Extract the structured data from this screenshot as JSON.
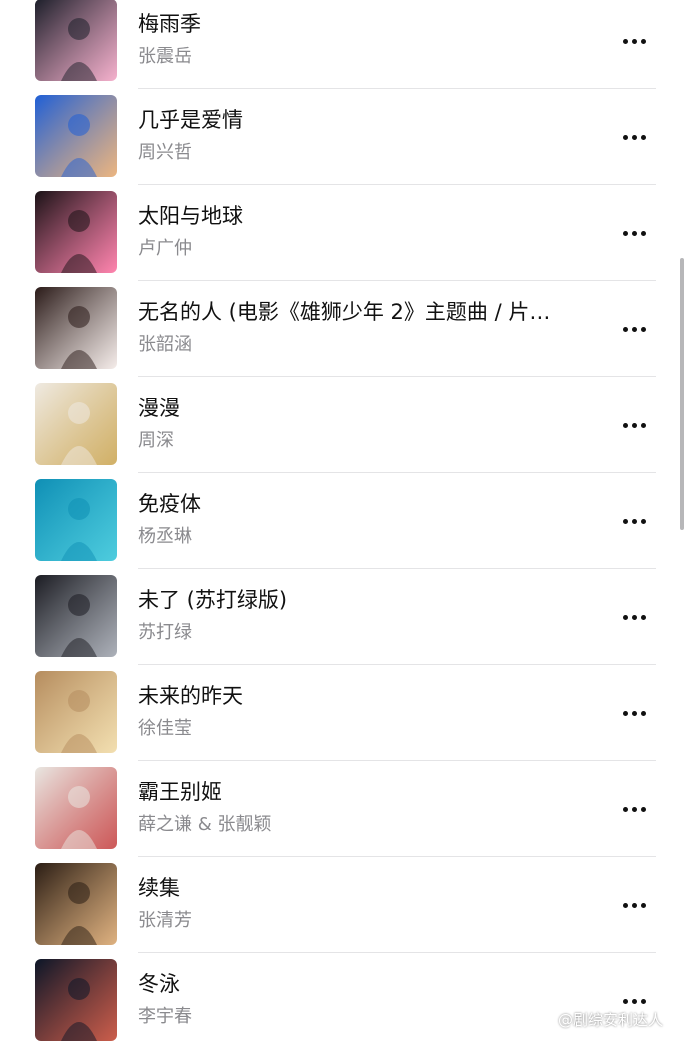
{
  "songs": [
    {
      "title": "梅雨季",
      "artist": "张震岳",
      "art": [
        "#1c1f2a",
        "#f3a3c4"
      ]
    },
    {
      "title": "几乎是爱情",
      "artist": "周兴哲",
      "art": [
        "#1f5fd6",
        "#e8a86a"
      ]
    },
    {
      "title": "太阳与地球",
      "artist": "卢广仲",
      "art": [
        "#1a1216",
        "#ff6fa0"
      ]
    },
    {
      "title": "无名的人 (电影《雄狮少年 2》主题曲 / 片…",
      "artist": "张韶涵",
      "art": [
        "#2a1a18",
        "#f3e9e6"
      ]
    },
    {
      "title": "漫漫",
      "artist": "周深",
      "art": [
        "#efeae2",
        "#c9a24b"
      ]
    },
    {
      "title": "免疫体",
      "artist": "杨丞琳",
      "art": [
        "#0f8fb5",
        "#2fc3d8"
      ]
    },
    {
      "title": "未了 (苏打绿版)",
      "artist": "苏打绿",
      "art": [
        "#1b1c22",
        "#9ea3ad"
      ]
    },
    {
      "title": "未来的昨天",
      "artist": "徐佳莹",
      "art": [
        "#b58c5e",
        "#f0d9a2"
      ]
    },
    {
      "title": "霸王别姬",
      "artist": "薛之谦 & 张靓颖",
      "art": [
        "#e9e7e2",
        "#c43b3b"
      ]
    },
    {
      "title": "续集",
      "artist": "张清芳",
      "art": [
        "#2a1d14",
        "#d9a46a"
      ]
    },
    {
      "title": "冬泳",
      "artist": "李宇春",
      "art": [
        "#0b1628",
        "#c2412c"
      ]
    }
  ],
  "watermark": {
    "text": "@剧综安利达人",
    "icon": "weibo-logo-icon"
  },
  "more_icon": "more-dots-icon"
}
